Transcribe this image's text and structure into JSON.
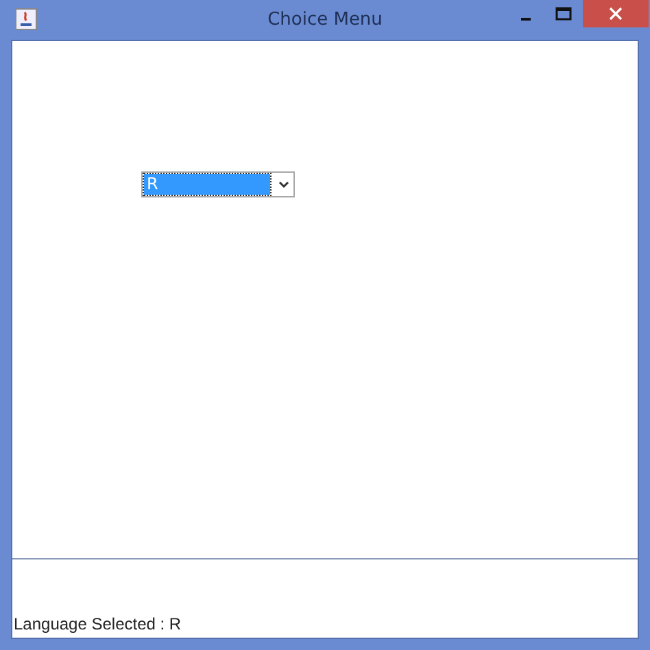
{
  "window": {
    "title": "Choice Menu"
  },
  "choice": {
    "value": "R",
    "focused": true
  },
  "status": "Language Selected : R"
}
